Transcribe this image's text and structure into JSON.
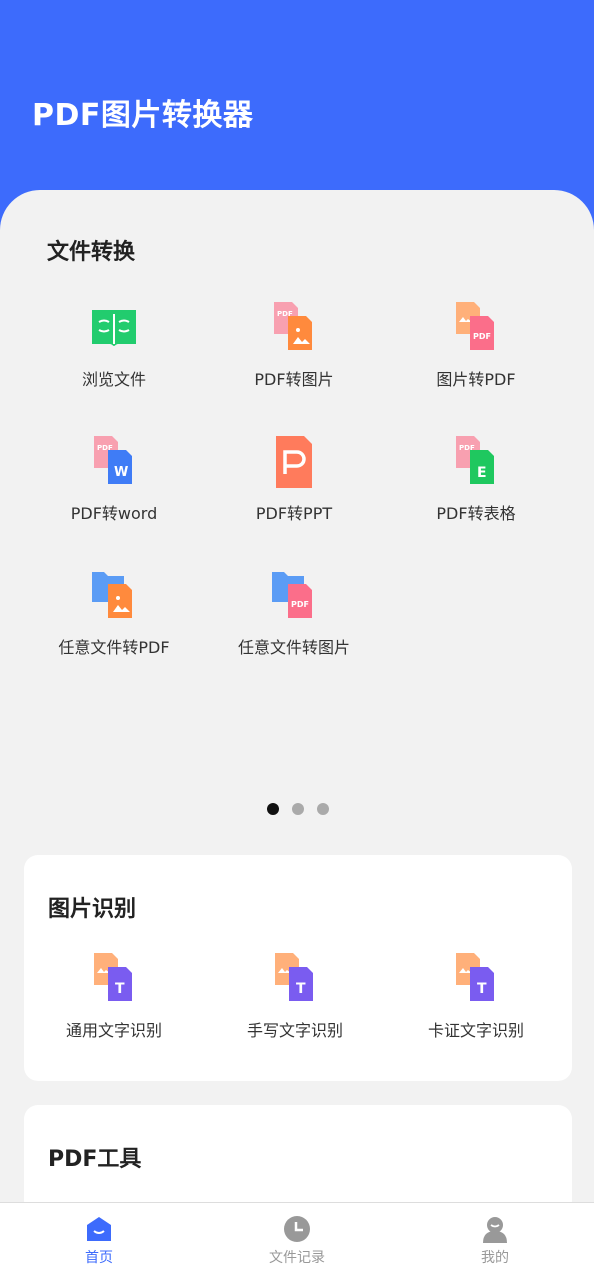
{
  "app": {
    "title": "PDF图片转换器"
  },
  "file_conversion": {
    "title": "文件转换",
    "items": [
      {
        "label": "浏览文件",
        "icon": "book-icon"
      },
      {
        "label": "PDF转图片",
        "icon": "pdf-to-image-icon"
      },
      {
        "label": "图片转PDF",
        "icon": "image-to-pdf-icon"
      },
      {
        "label": "PDF转word",
        "icon": "pdf-to-word-icon"
      },
      {
        "label": "PDF转PPT",
        "icon": "pdf-to-ppt-icon"
      },
      {
        "label": "PDF转表格",
        "icon": "pdf-to-excel-icon"
      },
      {
        "label": "任意文件转PDF",
        "icon": "file-to-pdf-icon"
      },
      {
        "label": "任意文件转图片",
        "icon": "file-to-image-icon"
      }
    ],
    "pager": {
      "pages": 3,
      "active": 1
    }
  },
  "image_recognition": {
    "title": "图片识别",
    "items": [
      {
        "label": "通用文字识别",
        "icon": "text-ocr-icon"
      },
      {
        "label": "手写文字识别",
        "icon": "handwriting-ocr-icon"
      },
      {
        "label": "卡证文字识别",
        "icon": "card-ocr-icon"
      }
    ]
  },
  "pdf_tools": {
    "title": "PDF工具"
  },
  "tabbar": {
    "tabs": [
      {
        "label": "首页",
        "icon": "home-icon",
        "active": true
      },
      {
        "label": "文件记录",
        "icon": "clock-icon",
        "active": false
      },
      {
        "label": "我的",
        "icon": "user-icon",
        "active": false
      }
    ]
  },
  "colors": {
    "primary": "#3d6bfc",
    "green": "#22cc6e",
    "pdf_pink": "#f47a8f",
    "pdf_red": "#fb6e8a",
    "orange": "#ff8a3d",
    "peach": "#ffb07a",
    "word_blue": "#3f7cf6",
    "ppt_orange": "#ff7b5c",
    "excel_green": "#1fc85f",
    "folder_blue": "#5b9cf5",
    "ocr_purple": "#7a5cf0"
  }
}
